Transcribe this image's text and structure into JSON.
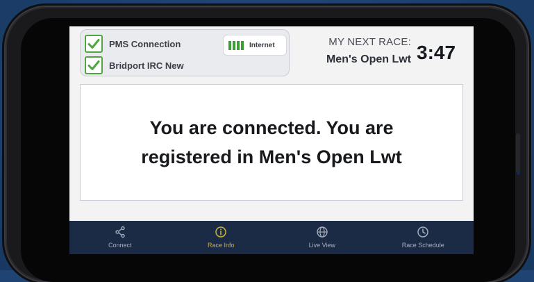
{
  "status": {
    "items": [
      {
        "label": "PMS Connection",
        "checked": true
      },
      {
        "label": "Bridport IRC New",
        "checked": true
      }
    ],
    "internet": {
      "label": "Internet",
      "signal_bars": 4
    }
  },
  "next_race": {
    "heading": "MY NEXT RACE:",
    "name": "Men's Open Lwt",
    "countdown": "3:47"
  },
  "message": "You are connected. You are registered in Men's Open Lwt",
  "tabs": [
    {
      "label": "Connect",
      "icon": "share-icon",
      "active": false
    },
    {
      "label": "Race Info",
      "icon": "info-icon",
      "active": true
    },
    {
      "label": "Live View",
      "icon": "globe-icon",
      "active": false
    },
    {
      "label": "Race Schedule",
      "icon": "clock-icon",
      "active": false
    }
  ],
  "colors": {
    "check_green": "#4fa63f",
    "tabbar_bg": "#1c2b45",
    "tab_active": "#c9b23a",
    "tab_inactive": "#a5adbb"
  }
}
